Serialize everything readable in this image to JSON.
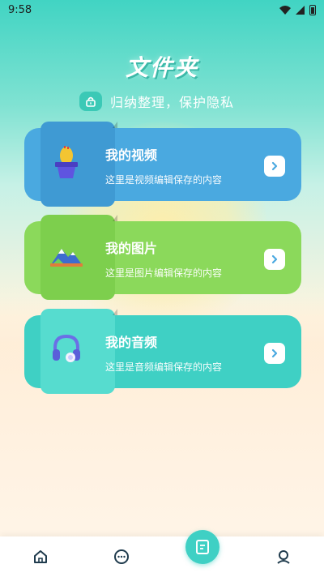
{
  "status_bar": {
    "time": "9:58"
  },
  "header": {
    "title": "文件夹",
    "subtitle": "归纳整理，保护隐私"
  },
  "cards": [
    {
      "title": "我的视频",
      "desc": "这里是视频编辑保存的内容",
      "icon": "cactus-pot-icon"
    },
    {
      "title": "我的图片",
      "desc": "这里是图片编辑保存的内容",
      "icon": "mountain-icon"
    },
    {
      "title": "我的音频",
      "desc": "这里是音频编辑保存的内容",
      "icon": "headphones-icon"
    }
  ],
  "bottom_nav": {
    "items": [
      "home-icon",
      "chat-icon",
      "document-icon",
      "profile-icon"
    ],
    "active": "document-icon"
  },
  "colors": {
    "accent": "#3fd0c4",
    "video_card": "#4aa9e0",
    "photo_card": "#8bd95b",
    "audio_card": "#3fd0c4"
  }
}
